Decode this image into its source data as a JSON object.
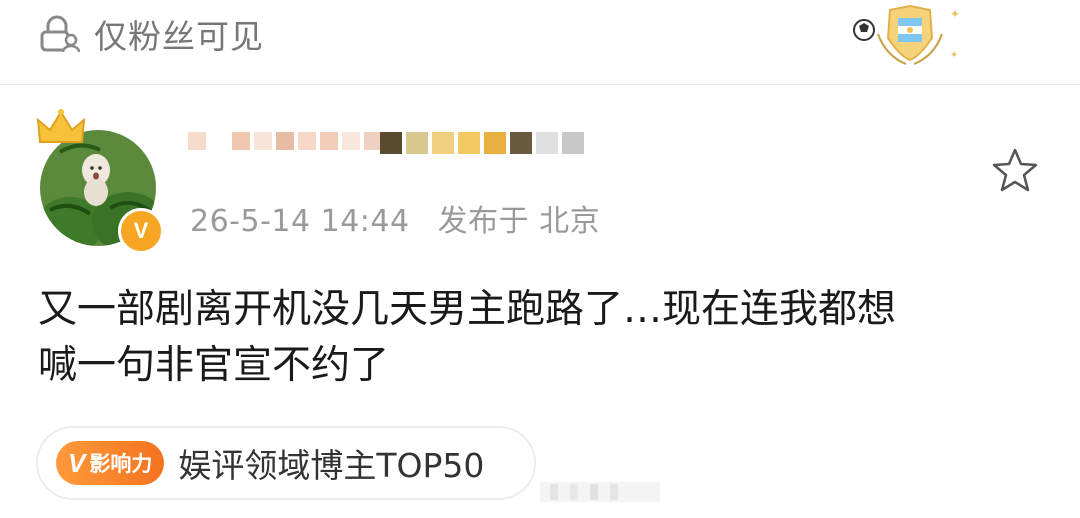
{
  "visibility": {
    "label": "仅粉丝可见",
    "icon": "lock-person-icon"
  },
  "post": {
    "timestamp": "26-5-14 14:44",
    "location": "发布于 北京",
    "content_line1": "又一部剧离开机没几天男主跑路了…现在连我都想",
    "content_line2": "喊一句非官宣不约了"
  },
  "user": {
    "verified_badge": "V"
  },
  "influence": {
    "badge_v": "V",
    "badge_label": "影响力",
    "rank_text": "娱评领域博主TOP50"
  },
  "colors": {
    "accent_orange": "#f4721f",
    "verified_orange": "#f7a623",
    "meta_gray": "#9a9a9a"
  }
}
